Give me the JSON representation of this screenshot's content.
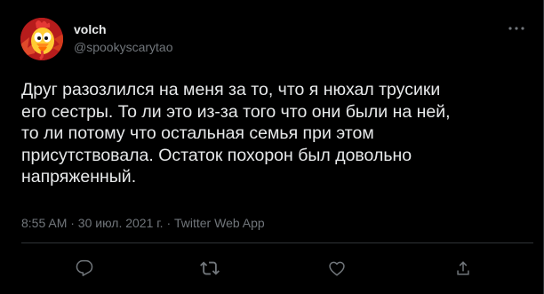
{
  "author": {
    "display_name": "volch",
    "handle": "@spookyscarytao",
    "avatar_icon": "cartoon-rooster-avatar"
  },
  "tweet": {
    "text": "Друг разозлился на меня за то, что я нюхал трусики\nего сестры. То ли это из-за того что они были на ней,\nто ли потому что остальная семья при этом\nприсутствовала. Остаток похорон был довольно\nнапряженный.",
    "timestamp": "8:55 AM · 30 июл. 2021 г. · Twitter Web App"
  },
  "actions": {
    "reply_icon": "reply-icon",
    "retweet_icon": "retweet-icon",
    "like_icon": "like-icon",
    "share_icon": "share-icon",
    "more_icon": "more-icon"
  },
  "colors": {
    "background": "#000000",
    "text_primary": "#e7e9ea",
    "text_secondary": "#71767b",
    "divider": "#2f3336"
  }
}
